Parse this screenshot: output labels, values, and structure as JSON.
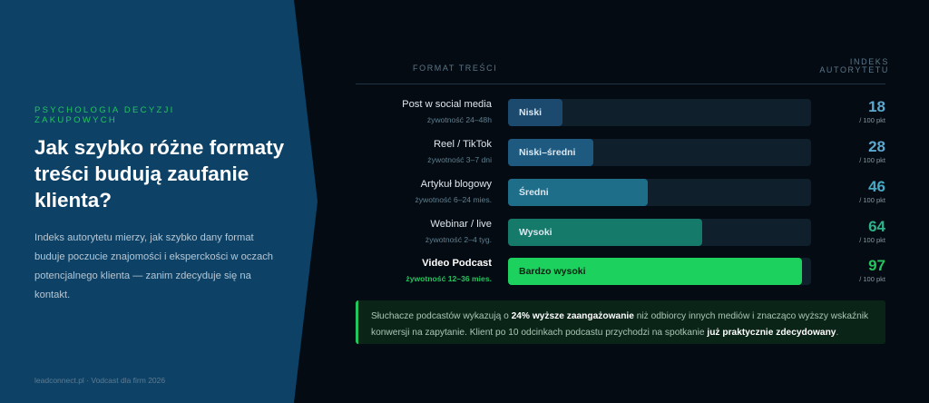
{
  "sidebar": {
    "eyebrow": "PSYCHOLOGIA DECYZJI ZAKUPOWYCH",
    "title": "Jak szybko różne formaty treści budują zaufanie klienta?",
    "description": "Indeks autorytetu mierzy, jak szybko dany format buduje poczucie znajomości i eksperckości w oczach potencjalnego klienta — zanim zdecyduje się na kontakt.",
    "footer": "leadconnect.pl · Vodcast dla firm 2026"
  },
  "chart_data": {
    "type": "bar",
    "orientation": "horizontal",
    "xlabel": "FORMAT TREŚCI",
    "ylabel": "INDEKS AUTORYTETU",
    "xlim": [
      0,
      100
    ],
    "unit": "/ 100 pkt",
    "categories": [
      "Post w social media",
      "Reel / TikTok",
      "Artykuł blogowy",
      "Webinar / live",
      "Video Podcast"
    ],
    "lifespans": [
      "żywotność 24–48h",
      "żywotność 3–7 dni",
      "żywotność 6–24 mies.",
      "żywotność 2–4 tyg.",
      "żywotność 12–36 mies."
    ],
    "bar_labels": [
      "Niski",
      "Niski–średni",
      "Średni",
      "Wysoki",
      "Bardzo wysoki"
    ],
    "values": [
      18,
      28,
      46,
      64,
      97
    ],
    "colors": [
      "#1c4a6e",
      "#1e5a80",
      "#1e6e8a",
      "#167a6b",
      "#1dd15f"
    ],
    "score_colors": [
      "#5ba8d0",
      "#5ba8d0",
      "#47a9c4",
      "#2fb38a",
      "#22c55e"
    ],
    "label_colors": [
      "#dbe7ef",
      "#dbe7ef",
      "#dbe7ef",
      "#dbe7ef",
      "#07210f"
    ],
    "highlight_index": 4
  },
  "callout": {
    "text_1": "Słuchacze podcastów wykazują o ",
    "bold_1": "24% wyższe zaangażowanie",
    "text_2": " niż odbiorcy innych mediów i znacząco wyższy wskaźnik konwersji na zapytanie. Klient po 10 odcinkach podcastu przychodzi na spotkanie ",
    "bold_2": "już praktycznie zdecydowany",
    "text_3": "."
  }
}
